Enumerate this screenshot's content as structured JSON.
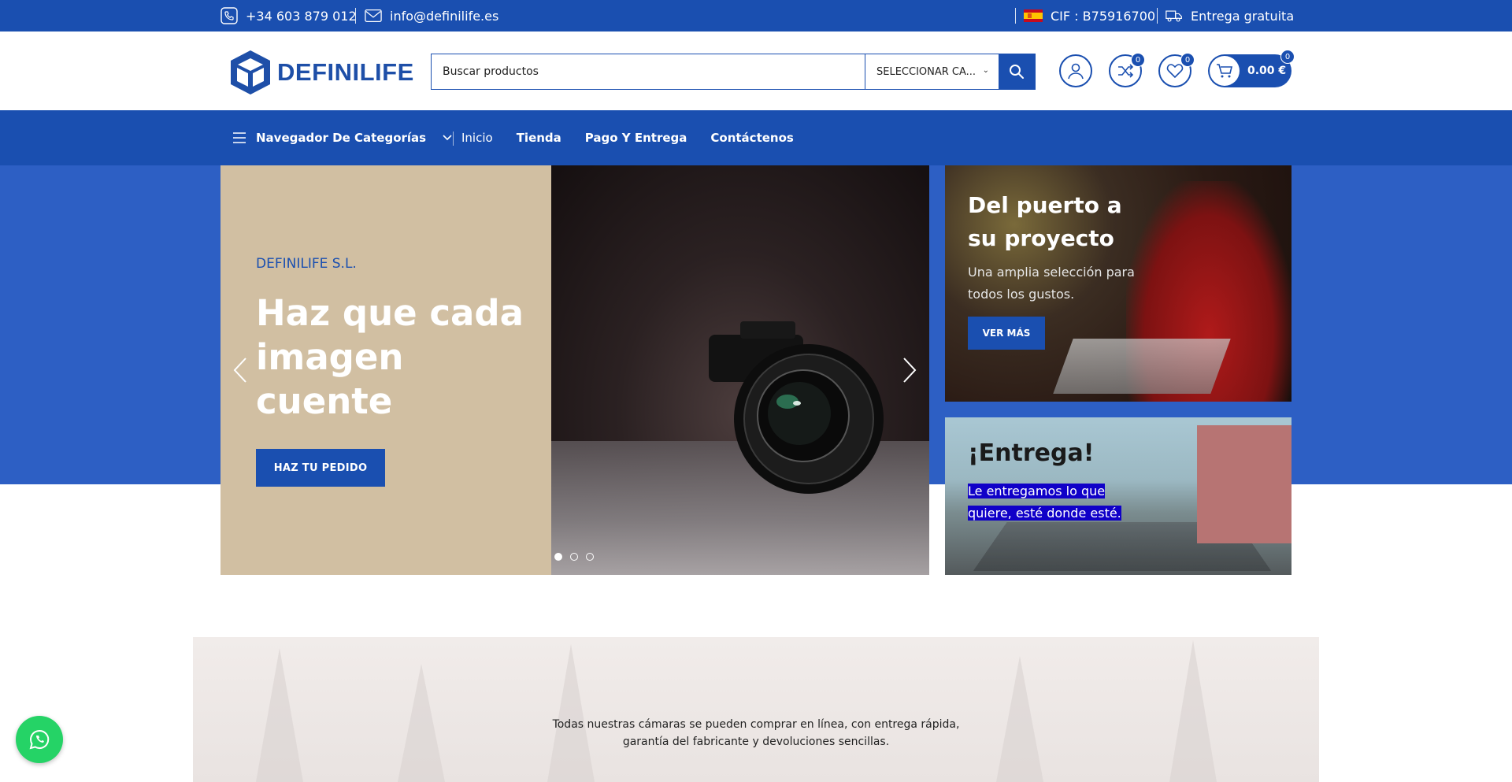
{
  "topbar": {
    "phone": "+34 603 879 012",
    "email": "info@definilife.es",
    "cif": "CIF : B75916700",
    "shipping": "Entrega gratuita"
  },
  "header": {
    "logo_text": "DEFINILIFE",
    "search_placeholder": "Buscar productos",
    "category_select": "SELECCIONAR CA...",
    "compare_count": "0",
    "wishlist_count": "0",
    "cart_count": "0",
    "cart_total": "0.00 €"
  },
  "nav": {
    "categories_label": "Navegador De Categorías",
    "links": [
      "Inicio",
      "Tienda",
      "Pago Y Entrega",
      "Contáctenos"
    ]
  },
  "slider": {
    "eyebrow": "DEFINILIFE S.L.",
    "headline": "Haz que cada imagen cuente",
    "cta": "HAZ TU PEDIDO",
    "slides": 3,
    "active_slide": 1
  },
  "banner1": {
    "title": "Del puerto a su proyecto",
    "subtitle": "Una amplia selección para todos los gustos.",
    "button": "VER MÁS"
  },
  "banner2": {
    "title": "¡Entrega!",
    "subtitle": "Le entregamos lo que quiere, esté donde esté."
  },
  "promo": {
    "line1": "Todas nuestras cámaras se pueden comprar en línea, con entrega rápida,",
    "line2": "garantía del fabricante y devoluciones sencillas."
  },
  "colors": {
    "brand_blue": "#1a4fb0",
    "hero_band": "#2d5fc4",
    "slide_beige": "#d1bfa2",
    "whatsapp_green": "#25d366"
  },
  "icons": [
    "phone-icon",
    "mail-icon",
    "spain-flag-icon",
    "truck-icon",
    "search-icon",
    "user-icon",
    "compare-icon",
    "heart-icon",
    "cart-icon",
    "menu-icon",
    "chevron-down-icon",
    "arrow-left-icon",
    "arrow-right-icon",
    "whatsapp-icon"
  ]
}
